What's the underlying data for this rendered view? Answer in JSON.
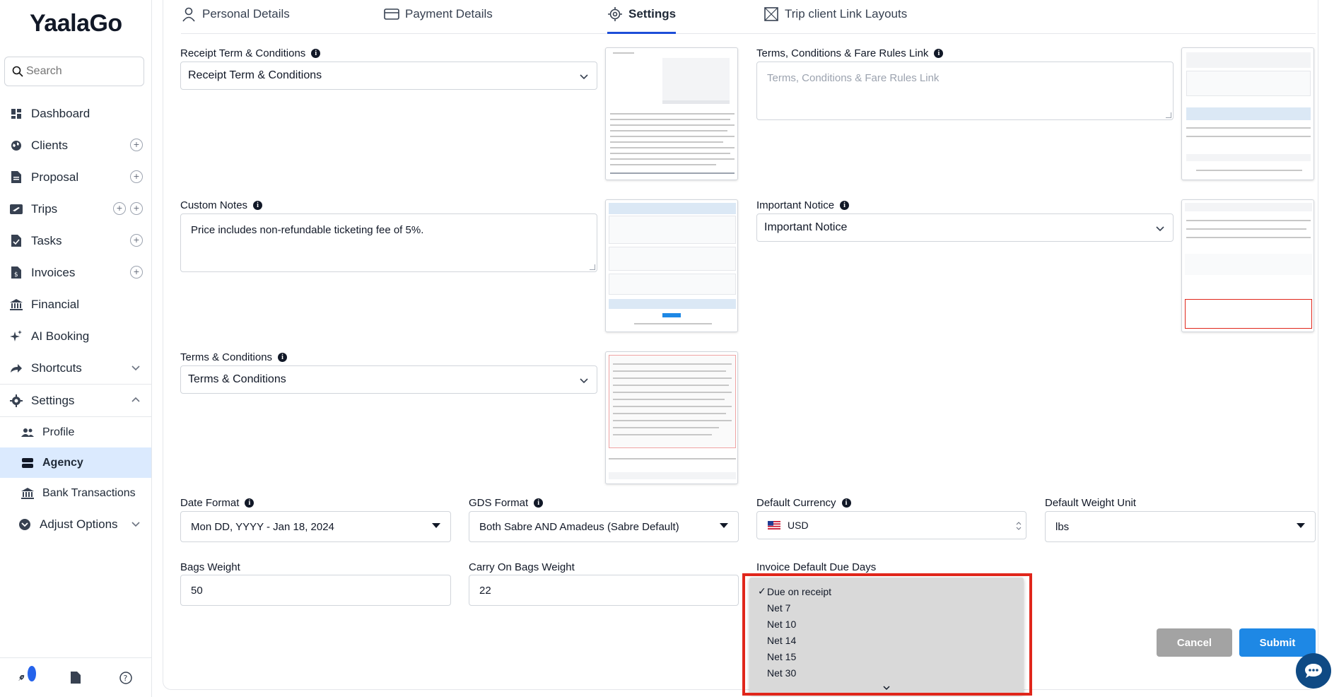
{
  "app": {
    "logo": "YaalaGo"
  },
  "search": {
    "placeholder": "Search"
  },
  "sidebar": {
    "items": [
      {
        "label": "Dashboard"
      },
      {
        "label": "Clients"
      },
      {
        "label": "Proposal"
      },
      {
        "label": "Trips"
      },
      {
        "label": "Tasks"
      },
      {
        "label": "Invoices"
      },
      {
        "label": "Financial"
      },
      {
        "label": "AI Booking"
      },
      {
        "label": "Shortcuts"
      },
      {
        "label": "Settings"
      }
    ],
    "settings_sub": [
      {
        "label": "Profile"
      },
      {
        "label": "Agency"
      },
      {
        "label": "Bank Transactions"
      }
    ],
    "adjust_options": "Adjust Options"
  },
  "tabs": [
    {
      "label": "Personal Details"
    },
    {
      "label": "Payment Details"
    },
    {
      "label": "Settings"
    },
    {
      "label": "Trip client Link Layouts"
    }
  ],
  "form": {
    "receipt_terms": {
      "label": "Receipt Term & Conditions",
      "value": "Receipt Term & Conditions"
    },
    "fare_rules_link": {
      "label": "Terms, Conditions & Fare Rules Link",
      "placeholder": "Terms, Conditions & Fare Rules Link"
    },
    "custom_notes": {
      "label": "Custom Notes",
      "value": "Price includes non-refundable ticketing fee of 5%."
    },
    "important_notice": {
      "label": "Important Notice",
      "value": "Important Notice"
    },
    "terms_conditions": {
      "label": "Terms & Conditions",
      "value": "Terms & Conditions"
    },
    "date_format": {
      "label": "Date Format",
      "value": "Mon DD, YYYY - Jan 18, 2024"
    },
    "gds_format": {
      "label": "GDS Format",
      "value": "Both Sabre AND Amadeus (Sabre Default)"
    },
    "default_currency": {
      "label": "Default Currency",
      "value": "USD"
    },
    "default_weight_unit": {
      "label": "Default Weight Unit",
      "value": "lbs"
    },
    "bags_weight": {
      "label": "Bags Weight",
      "value": "50"
    },
    "carry_on_weight": {
      "label": "Carry On Bags Weight",
      "value": "22"
    },
    "invoice_due_days": {
      "label": "Invoice Default Due Days",
      "options": [
        "Due on receipt",
        "Net 7",
        "Net 10",
        "Net 14",
        "Net 15",
        "Net 30"
      ],
      "selected": "Due on receipt",
      "check": "✓"
    }
  },
  "buttons": {
    "cancel": "Cancel",
    "submit": "Submit"
  },
  "colors": {
    "accent": "#1e88e5",
    "active_tab": "#1d4ed8",
    "highlight": "#e0261b",
    "active_nav_bg": "#dbeafe",
    "chat": "#0f4a84"
  }
}
